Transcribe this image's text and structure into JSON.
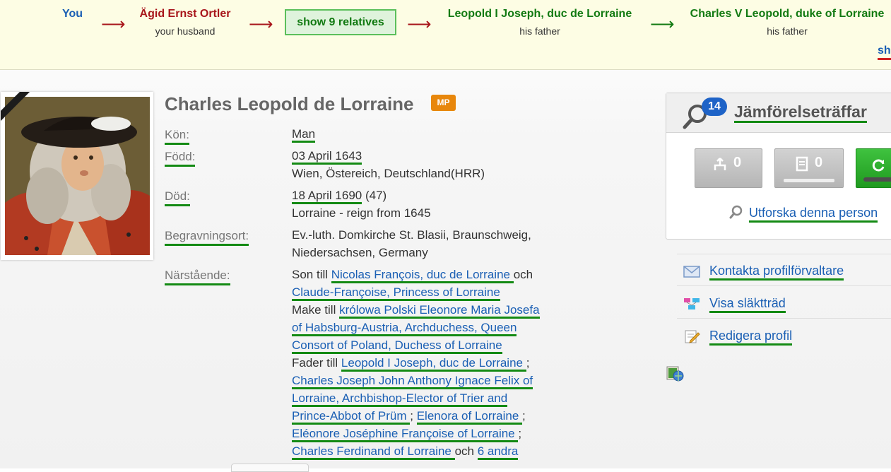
{
  "path": {
    "you": "You",
    "husband_name": "Ägid Ernst Ortler",
    "husband_rel": "your husband",
    "show_relatives": "show 9 relatives",
    "father1_name": "Leopold I Joseph, duc de Lorraine",
    "father1_rel": "his father",
    "father2_name": "Charles V Leopold, duke of Lorraine",
    "father2_rel": "his father",
    "more": "sh",
    "arrow": "⟶"
  },
  "profile": {
    "name": "Charles Leopold de Lorraine",
    "badge": "MP",
    "gender_label": "Kön:",
    "gender": "Man",
    "born_label": "Född:",
    "born_date": "03 April 1643",
    "born_place": "Wien, Östereich, Deutschland(HRR)",
    "died_label": "Död:",
    "died_date": "18 April 1690",
    "died_age": " (47)",
    "died_note": "Lorraine - reign from 1645",
    "burial_label": "Begravningsort:",
    "burial_line1": "Ev.-luth. Domkirche St. Blasii, Braunschweig,",
    "burial_line2": "Niedersachsen, Germany",
    "relatives_label": "Närstående:",
    "son_of": "Son till ",
    "parent1": " Nicolas François, duc de Lorraine ",
    "and": " och",
    "parent2": " Claude-Françoise, Princess of Lorraine ",
    "husband_of": "Make till ",
    "spouse_l1": " królowa Polski Eleonore Maria Josefa",
    "spouse_l2": "of Habsburg-Austria, Archduchess, Queen",
    "spouse_l3": "Consort of Poland, Duchess of Lorraine ",
    "father_of": "Fader till ",
    "child1": " Leopold I Joseph, duc de Lorraine ",
    "sep": ";",
    "child2_l1": " Charles Joseph John Anthony Ignace Felix of",
    "child2_l2": "Lorraine, Archbishop-Elector of Trier and",
    "child2_l3": "Prince-Abbot of Prüm ",
    "child3": " Elenora of Lorraine ",
    "child4": " Eléonore Joséphine Françoise of Lorraine ",
    "child5": " Charles Ferdinand of Lorraine ",
    "and2": " och ",
    "others": " 6 andra"
  },
  "matches": {
    "count": "14",
    "title": "Jämförelseträffar",
    "tree_count": "0",
    "record_count": "0",
    "explore": "Utforska denna person"
  },
  "side": {
    "contact": "Kontakta profilförvaltare",
    "tree": "Visa släktträd",
    "edit": "Redigera profil"
  },
  "colors": {
    "path_bg": "#fdfde4",
    "link": "#1a5fb4",
    "underline": "#138a13",
    "badge": "#e8870c",
    "match_badge": "#1e63c7"
  }
}
